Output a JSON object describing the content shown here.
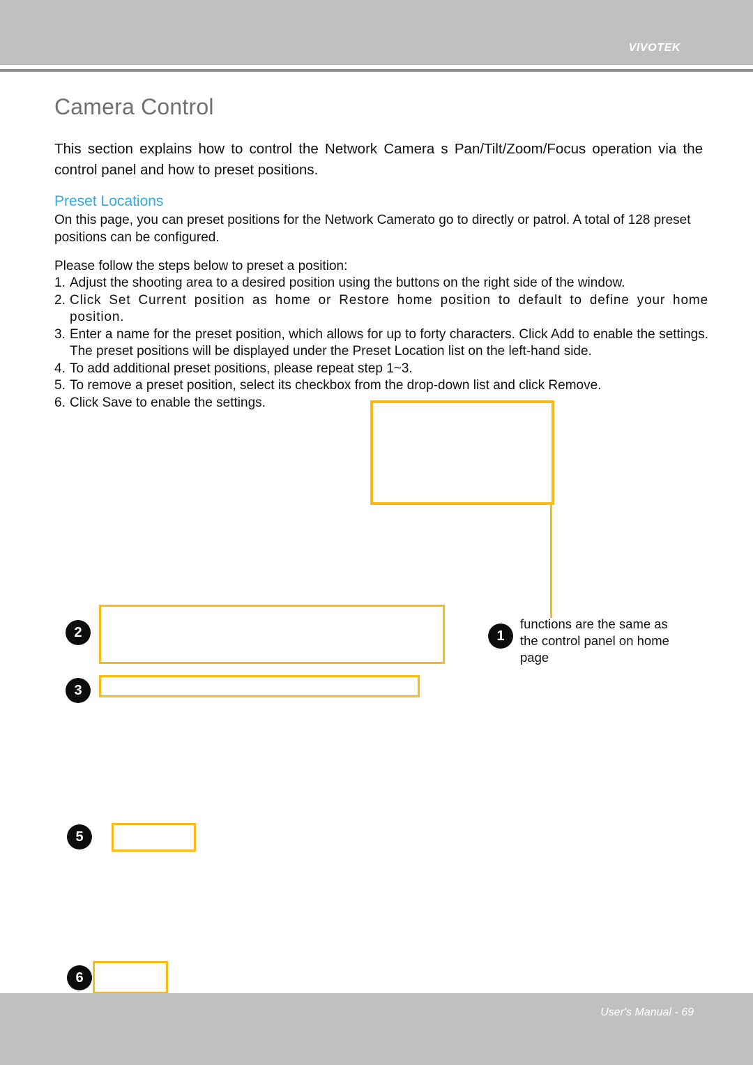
{
  "header": {
    "brand": "VIVOTEK"
  },
  "page": {
    "title": "Camera Control",
    "intro": "This section explains how to control the Network Camera s Pan/Tilt/Zoom/Focus operation via the control panel and how to preset positions."
  },
  "section": {
    "heading": "Preset Locations",
    "body": "On this page, you can preset positions for the Network Camerato go to directly or patrol. A total of 128 preset positions can be configured.",
    "steps_intro": "Please follow the steps below to preset a position:",
    "steps": [
      {
        "number": "1.",
        "text": "Adjust the shooting area to a desired position using the buttons on the right side of the window."
      },
      {
        "number": "2.",
        "text": "Click Set Current position as home or Restore home position to default to define your home position."
      },
      {
        "number": "3.",
        "text": "Enter a name for the preset position, which allows for up to forty characters. Click Add to enable the settings. The preset positions will be displayed under the Preset Location list on the left-hand side."
      },
      {
        "number": "4.",
        "text": "To add additional preset positions, please repeat step 1~3."
      },
      {
        "number": "5.",
        "text": "To remove a preset position, select its checkbox from the drop-down list and click Remove."
      },
      {
        "number": "6.",
        "text": "Click Save to enable the settings."
      }
    ]
  },
  "callouts": {
    "markers": [
      {
        "id": "1",
        "label": "1"
      },
      {
        "id": "2",
        "label": "2"
      },
      {
        "id": "3",
        "label": "3"
      },
      {
        "id": "5",
        "label": "5"
      },
      {
        "id": "6",
        "label": "6"
      }
    ],
    "note_1": "functions are the same as the control panel on home page",
    "accent_color": "#FBBA16"
  },
  "footer": {
    "text": "User's Manual - 69"
  }
}
